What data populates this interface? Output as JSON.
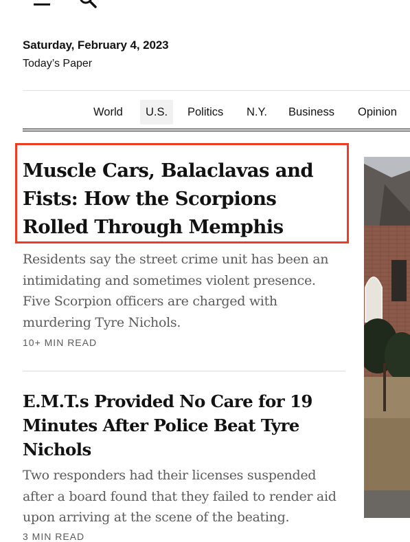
{
  "header": {
    "menu_icon": "hamburger-menu-icon",
    "search_icon": "magnifier-icon",
    "date": "Saturday, February 4, 2023",
    "todays_paper": "Today’s Paper"
  },
  "nav": {
    "items": [
      {
        "label": "World"
      },
      {
        "label": "U.S.",
        "active": true
      },
      {
        "label": "Politics"
      },
      {
        "label": "N.Y."
      },
      {
        "label": "Business"
      },
      {
        "label": "Opinion"
      }
    ]
  },
  "stories": [
    {
      "headline": "Muscle Cars, Balaclavas and Fists: How the Scorpions Rolled Through Memphis",
      "summary": "Residents say the street crime unit has been an intimidating and sometimes violent presence. Five Scorpion officers are charged with murdering Tyre Nichols.",
      "read_time": "10+ MIN READ"
    },
    {
      "headline": "E.M.T.s Provided No Care for 19 Minutes After Police Beat Tyre Nichols",
      "summary": "Two responders had their licenses suspended after a board found that they failed to render aid upon arriving at the scene of the beating.",
      "read_time": "3 MIN READ"
    }
  ],
  "colors": {
    "highlight": "#ef3b24",
    "text": "#121212",
    "summary_text": "#5a5a5a",
    "nav_active_bg": "#f1f1f1"
  }
}
